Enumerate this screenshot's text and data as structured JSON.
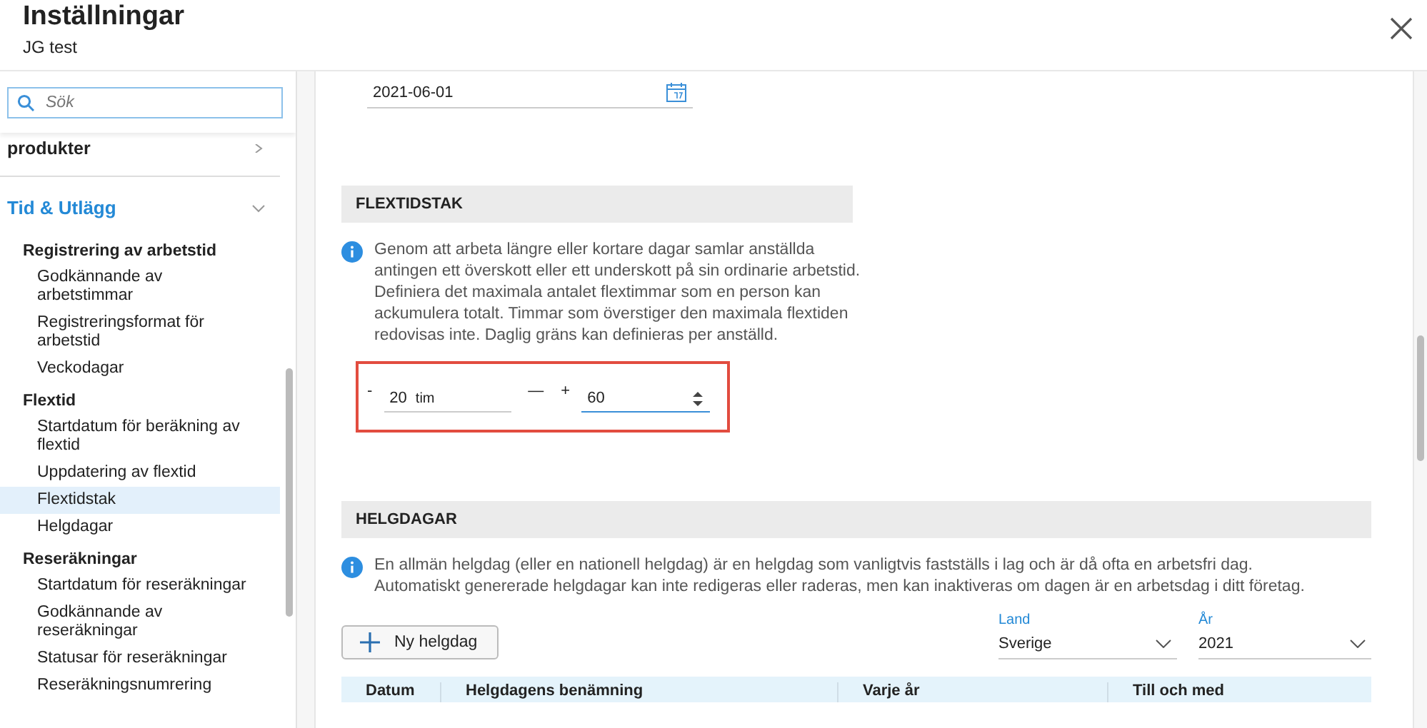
{
  "window": {
    "title": "Inställningar",
    "subtitle": "JG test"
  },
  "search": {
    "placeholder": "Sök"
  },
  "sidebar": {
    "sections": [
      {
        "label": "produkter",
        "expanded": false
      },
      {
        "label": "Tid & Utlägg",
        "expanded": true,
        "groups": [
          {
            "label": "Registrering av arbetstid",
            "items": [
              {
                "label": "Godkännande av arbetstimmar",
                "selected": false
              },
              {
                "label": "Registreringsformat för arbetstid",
                "selected": false
              },
              {
                "label": "Veckodagar",
                "selected": false
              }
            ]
          },
          {
            "label": "Flextid",
            "items": [
              {
                "label": "Startdatum för beräkning av flextid",
                "selected": false
              },
              {
                "label": "Uppdatering av flextid",
                "selected": false
              },
              {
                "label": "Flextidstak",
                "selected": true
              },
              {
                "label": "Helgdagar",
                "selected": false
              }
            ]
          },
          {
            "label": "Reseräkningar",
            "items": [
              {
                "label": "Startdatum för reseräkningar",
                "selected": false
              },
              {
                "label": "Godkännande av reseräkningar",
                "selected": false
              },
              {
                "label": "Statusar för reseräkningar",
                "selected": false
              },
              {
                "label": "Reseräkningsnumrering",
                "selected": false
              }
            ]
          }
        ]
      }
    ]
  },
  "date_field": {
    "value": "2021-06-01"
  },
  "flextidstak": {
    "title": "FLEXTIDSTAK",
    "info": "Genom att arbeta längre eller kortare dagar samlar anställda antingen ett överskott eller ett underskott på sin ordinarie arbetstid. Definiera det maximala antalet flextimmar som en person kan ackumulera totalt. Timmar som överstiger den maximala flextiden redovisas inte. Daglig gräns kan definieras per anställd.",
    "min": {
      "sign": "-",
      "value": "20",
      "unit": "tim"
    },
    "separator": "—",
    "max": {
      "sign": "+",
      "value": "60"
    }
  },
  "helgdagar": {
    "title": "HELGDAGAR",
    "info_lines": [
      "En allmän helgdag (eller en nationell helgdag) är en helgdag som vanligtvis fastställs i lag och är då ofta en arbetsfri dag.",
      "Automatiskt genererade helgdagar kan inte redigeras eller raderas, men kan inaktiveras om dagen är en arbetsdag i ditt företag."
    ],
    "add_button": "Ny helgdag",
    "country": {
      "label": "Land",
      "value": "Sverige"
    },
    "year": {
      "label": "År",
      "value": "2021"
    },
    "columns": [
      "Datum",
      "Helgdagens benämning",
      "Varje år",
      "Till och med"
    ]
  }
}
